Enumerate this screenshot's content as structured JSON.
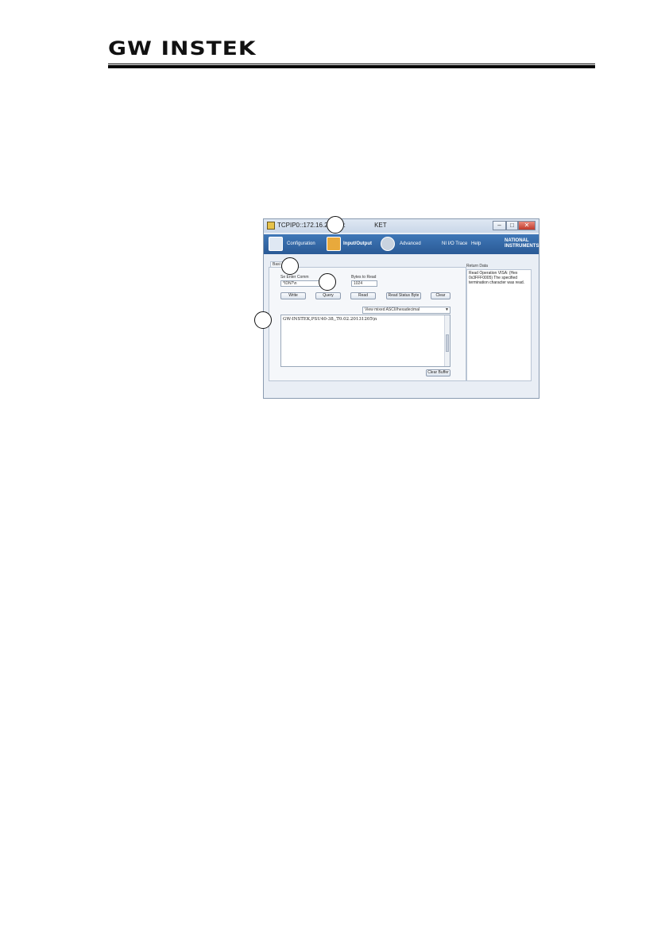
{
  "header": {
    "logo_text": "GW INSTEK"
  },
  "window": {
    "title": "TCPIP0::172.16.22.134:",
    "title_tail": "KET",
    "controls": {
      "minimize": "–",
      "maximize": "□",
      "close": "✕"
    },
    "toolbar": {
      "configuration": "Configuration",
      "input_output": "Input/Output",
      "advanced": "Advanced",
      "ni_io_trace": "NI I/O Trace",
      "help": "Help",
      "brand_line1": "NATIONAL",
      "brand_line2": "INSTRUMENTS"
    },
    "tab_label": "Basi",
    "command_label": "Se   Enter Comm",
    "command_value": "*IDN?\\n",
    "bytes_label": "Bytes to Read",
    "bytes_value": "1024",
    "buttons": {
      "write": "Write",
      "query": "Query",
      "read": "Read",
      "read_status_byte": "Read Status Byte",
      "clear": "Clear",
      "clear_buffer": "Clear Buffer"
    },
    "view_mode": "View mixed ASCII/hexadecimal",
    "output_text": "GW-INSTEK,PSU40-38,,T0.02.20131205\\n",
    "return_data_label": "Return Data",
    "return_data_text": "Read Operation VISA: (Hex 0x3FFF0005) The specified termination character was read."
  },
  "callouts": [
    "1",
    "2",
    "3",
    "4"
  ]
}
